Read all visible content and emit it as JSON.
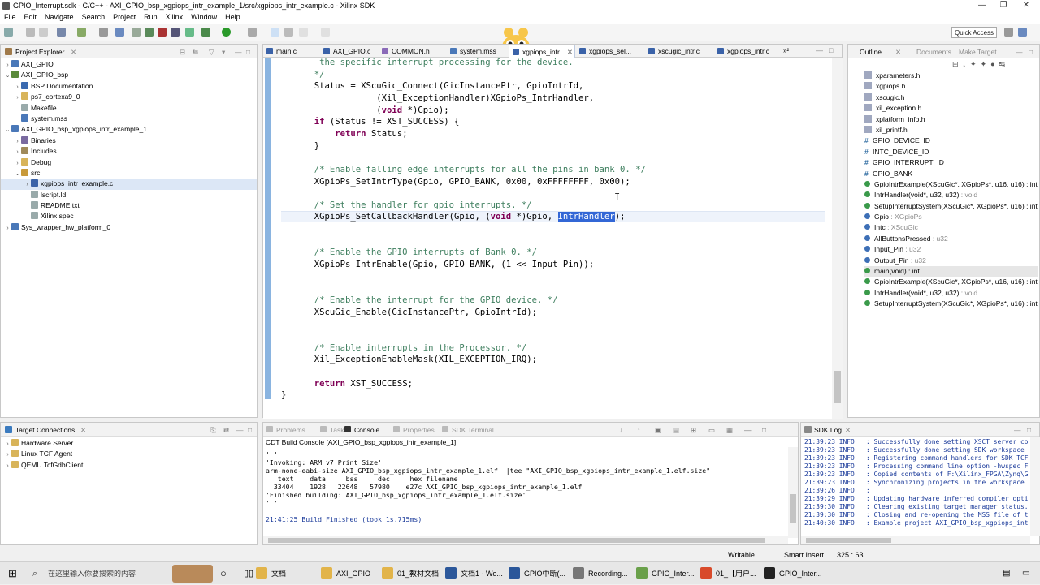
{
  "window": {
    "title": "GPIO_Interrupt.sdk - C/C++ - AXI_GPIO_bsp_xgpiops_intr_example_1/src/xgpiops_intr_example.c - Xilinx SDK"
  },
  "menu": [
    "File",
    "Edit",
    "Navigate",
    "Search",
    "Project",
    "Run",
    "Xilinx",
    "Window",
    "Help"
  ],
  "toolbar": {
    "quick_access": "Quick Access"
  },
  "explorer": {
    "title": "Project Explorer",
    "items": [
      {
        "label": "AXI_GPIO",
        "level": 0,
        "arrow": "›",
        "icon": "project-icon"
      },
      {
        "label": "AXI_GPIO_bsp",
        "level": 0,
        "arrow": "⌄",
        "icon": "bsp-icon"
      },
      {
        "label": "BSP Documentation",
        "level": 1,
        "arrow": "›",
        "icon": "info-icon"
      },
      {
        "label": "ps7_cortexa9_0",
        "level": 1,
        "arrow": "›",
        "icon": "folder-icon"
      },
      {
        "label": "Makefile",
        "level": 1,
        "arrow": "",
        "icon": "file-icon"
      },
      {
        "label": "system.mss",
        "level": 1,
        "arrow": "",
        "icon": "mss-icon"
      },
      {
        "label": "AXI_GPIO_bsp_xgpiops_intr_example_1",
        "level": 0,
        "arrow": "⌄",
        "icon": "project-icon"
      },
      {
        "label": "Binaries",
        "level": 1,
        "arrow": "›",
        "icon": "binaries-icon"
      },
      {
        "label": "Includes",
        "level": 1,
        "arrow": "›",
        "icon": "includes-icon"
      },
      {
        "label": "Debug",
        "level": 1,
        "arrow": "›",
        "icon": "folder-icon"
      },
      {
        "label": "src",
        "level": 1,
        "arrow": "⌄",
        "icon": "src-icon"
      },
      {
        "label": "xgpiops_intr_example.c",
        "level": 2,
        "arrow": "›",
        "icon": "c-file-icon",
        "selected": true
      },
      {
        "label": "lscript.ld",
        "level": 2,
        "arrow": "",
        "icon": "file-icon"
      },
      {
        "label": "README.txt",
        "level": 2,
        "arrow": "",
        "icon": "file-icon"
      },
      {
        "label": "Xilinx.spec",
        "level": 2,
        "arrow": "",
        "icon": "file-icon"
      },
      {
        "label": "Sys_wrapper_hw_platform_0",
        "level": 0,
        "arrow": "›",
        "icon": "project-icon"
      }
    ]
  },
  "editor_tabs": [
    "main.c",
    "AXI_GPIO.c",
    "COMMON.h",
    "system.mss",
    "xgpiops_intr...",
    "xgpiops_sel...",
    "xscugic_intr.c",
    "xgpiops_intr.c"
  ],
  "editor_overflow": "»²",
  "code": [
    {
      "t": "   the specific interrupt processing for the device.",
      "c": "cm"
    },
    {
      "t": "  */",
      "c": "cm"
    },
    {
      "t": "  Status = XScuGic_Connect(GicInstancePtr, GpioIntrId,",
      "c": ""
    },
    {
      "t": "              (Xil_ExceptionHandler)XGpioPs_IntrHandler,",
      "c": ""
    },
    {
      "t": "              (void *)Gpio);",
      "c": "void"
    },
    {
      "t": "  if (Status != XST_SUCCESS) {",
      "c": "if"
    },
    {
      "t": "      return Status;",
      "c": "ret"
    },
    {
      "t": "  }",
      "c": ""
    },
    {
      "t": "",
      "c": ""
    },
    {
      "t": "  /* Enable falling edge interrupts for all the pins in bank 0. */",
      "c": "cm"
    },
    {
      "t": "  XGpioPs_SetIntrType(Gpio, GPIO_BANK, 0x00, 0xFFFFFFFF, 0x00);",
      "c": ""
    },
    {
      "t": "",
      "c": ""
    },
    {
      "t": "  /* Set the handler for gpio interrupts. */",
      "c": "cm"
    },
    {
      "t": "  XGpioPs_SetCallbackHandler(Gpio, (void *)Gpio, IntrHandler);",
      "c": "cb"
    },
    {
      "t": "",
      "c": ""
    },
    {
      "t": "",
      "c": ""
    },
    {
      "t": "  /* Enable the GPIO interrupts of Bank 0. */",
      "c": "cm"
    },
    {
      "t": "  XGpioPs_IntrEnable(Gpio, GPIO_BANK, (1 << Input_Pin));",
      "c": ""
    },
    {
      "t": "",
      "c": ""
    },
    {
      "t": "",
      "c": ""
    },
    {
      "t": "  /* Enable the interrupt for the GPIO device. */",
      "c": "cm"
    },
    {
      "t": "  XScuGic_Enable(GicInstancePtr, GpioIntrId);",
      "c": ""
    },
    {
      "t": "",
      "c": ""
    },
    {
      "t": "",
      "c": ""
    },
    {
      "t": "  /* Enable interrupts in the Processor. */",
      "c": "cm"
    },
    {
      "t": "  Xil_ExceptionEnableMask(XIL_EXCEPTION_IRQ);",
      "c": ""
    },
    {
      "t": "",
      "c": ""
    },
    {
      "t": "  return XST_SUCCESS;",
      "c": "ret"
    },
    {
      "t": "}",
      "c": "brace"
    }
  ],
  "outline": {
    "tabs": [
      "Outline",
      "Documents",
      "Make Target"
    ],
    "items": [
      {
        "kind": "inc",
        "label": "xparameters.h"
      },
      {
        "kind": "inc",
        "label": "xgpiops.h"
      },
      {
        "kind": "inc",
        "label": "xscugic.h"
      },
      {
        "kind": "inc",
        "label": "xil_exception.h"
      },
      {
        "kind": "inc",
        "label": "xplatform_info.h"
      },
      {
        "kind": "inc",
        "label": "xil_printf.h"
      },
      {
        "kind": "def",
        "label": "GPIO_DEVICE_ID"
      },
      {
        "kind": "def",
        "label": "INTC_DEVICE_ID"
      },
      {
        "kind": "def",
        "label": "GPIO_INTERRUPT_ID"
      },
      {
        "kind": "def",
        "label": "GPIO_BANK"
      },
      {
        "kind": "fn",
        "label": "GpioIntrExample(XScuGic*, XGpioPs*, u16, u16) : int"
      },
      {
        "kind": "fnS",
        "label": "IntrHandler(void*, u32, u32)",
        "type": " : void"
      },
      {
        "kind": "fnS",
        "label": "SetupInterruptSystem(XScuGic*, XGpioPs*, u16) : int"
      },
      {
        "kind": "var",
        "label": "Gpio",
        "type": " : XGpioPs"
      },
      {
        "kind": "var",
        "label": "Intc",
        "type": " : XScuGic"
      },
      {
        "kind": "var",
        "label": "AllButtonsPressed",
        "type": " : u32"
      },
      {
        "kind": "var",
        "label": "Input_Pin",
        "type": " : u32"
      },
      {
        "kind": "var",
        "label": "Output_Pin",
        "type": " : u32"
      },
      {
        "kind": "fnsel",
        "label": "main(void) : int"
      },
      {
        "kind": "fn",
        "label": "GpioIntrExample(XScuGic*, XGpioPs*, u16, u16) : int"
      },
      {
        "kind": "fnS",
        "label": "IntrHandler(void*, u32, u32)",
        "type": " : void"
      },
      {
        "kind": "fnS",
        "label": "SetupInterruptSystem(XScuGic*, XGpioPs*, u16) : int"
      }
    ]
  },
  "target": {
    "title": "Target Connections",
    "items": [
      "Hardware Server",
      "Linux TCF Agent",
      "QEMU TcfGdbClient"
    ]
  },
  "console": {
    "tabs": [
      "Problems",
      "Tasks",
      "Console",
      "Properties",
      "SDK Terminal"
    ],
    "header": "CDT Build Console [AXI_GPIO_bsp_xgpiops_intr_example_1]",
    "lines": [
      "' '",
      "'Invoking: ARM v7 Print Size'",
      "arm-none-eabi-size AXI_GPIO_bsp_xgpiops_intr_example_1.elf  |tee \"AXI_GPIO_bsp_xgpiops_intr_example_1.elf.size\"",
      "   text    data     bss     dec     hex filename",
      "  33404    1928   22648   57980    e27c AXI_GPIO_bsp_xgpiops_intr_example_1.elf",
      "'Finished building: AXI_GPIO_bsp_xgpiops_intr_example_1.elf.size'",
      "' '",
      "",
      "21:41:25 Build Finished (took 1s.715ms)"
    ]
  },
  "sdklog": {
    "title": "SDK Log",
    "lines": [
      "21:39:23 INFO   : Successfully done setting XSCT server co",
      "21:39:23 INFO   : Successfully done setting SDK workspace",
      "21:39:23 INFO   : Registering command handlers for SDK TCF",
      "21:39:23 INFO   : Processing command line option -hwspec F",
      "21:39:23 INFO   : Copied contents of F:\\Xilinx_FPGA\\Zynq\\G",
      "21:39:23 INFO   : Synchronizing projects in the workspace",
      "21:39:26 INFO   :",
      "21:39:29 INFO   : Updating hardware inferred compiler optio",
      "21:39:30 INFO   : Clearing existing target manager status.",
      "21:39:30 INFO   : Closing and re-opening the MSS file of t",
      "21:40:30 INFO   : Example project AXI_GPIO_bsp_xgpiops_int"
    ]
  },
  "status": {
    "mode": "Writable",
    "insert": "Smart Insert",
    "position": "325 : 63"
  },
  "taskbar": {
    "search": "在这里输入你要搜索的内容",
    "items": [
      "文档",
      "AXI_GPIO",
      "01_教材文档",
      "文档1 - Wo...",
      "GPIO中断(...",
      "Recording...",
      "GPIO_Inter...",
      "01_【用户...",
      "GPIO_Inter..."
    ]
  },
  "colors": {
    "comment": "#3f7f5f",
    "keyword": "#7f0055",
    "selection": "#3367d6",
    "editor_bar": "#8ab4e0"
  }
}
